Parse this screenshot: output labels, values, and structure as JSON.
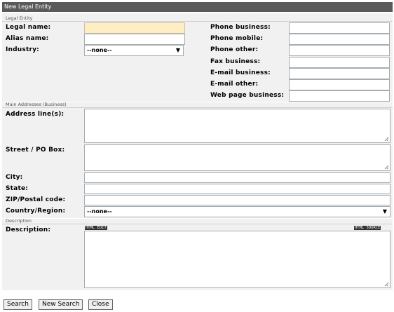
{
  "window": {
    "title": "New Legal Entity"
  },
  "sections": {
    "legal_entity": "Legal Entity",
    "main_addresses": "Main Addresses (Business)",
    "description": "Description"
  },
  "legal": {
    "legal_name_label": "Legal name:",
    "legal_name_value": "",
    "alias_label": "Alias name:",
    "alias_value": "",
    "industry_label": "Industry:",
    "industry_value": "--none--"
  },
  "phones": {
    "phone_business_label": "Phone business:",
    "phone_mobile_label": "Phone mobile:",
    "phone_other_label": "Phone other:",
    "fax_business_label": "Fax business:",
    "email_business_label": "E-mail business:",
    "email_other_label": "E-mail other:",
    "web_page_label": "Web page business:"
  },
  "address": {
    "address_lines_label": "Address line(s):",
    "street_label": "Street / PO Box:",
    "city_label": "City:",
    "state_label": "State:",
    "zip_label": "ZIP/Postal code:",
    "country_label": "Country/Region:",
    "country_value": "--none--"
  },
  "description": {
    "label": "Description:",
    "toolbar_left": "HTML EDIT",
    "toolbar_right": "HTML SOURCE"
  },
  "buttons": {
    "search": "Search",
    "new_search": "New Search",
    "close": "Close"
  }
}
